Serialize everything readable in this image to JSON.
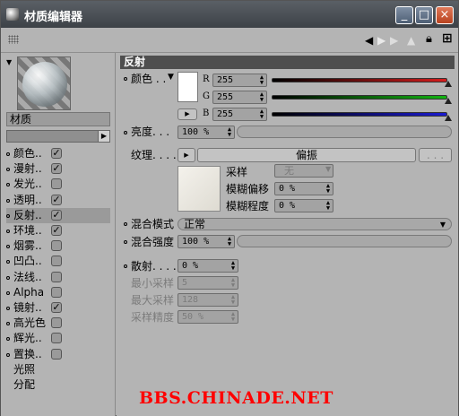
{
  "window": {
    "title": "材质编辑器",
    "min_label": "_",
    "max_label": "□",
    "close_label": "×"
  },
  "left": {
    "material_name": "材质",
    "channels": [
      {
        "label": "颜色..",
        "checked": true,
        "check": "✓"
      },
      {
        "label": "漫射..",
        "checked": true,
        "check": "✓"
      },
      {
        "label": "发光..",
        "checked": false,
        "check": ""
      },
      {
        "label": "透明..",
        "checked": true,
        "check": "✓"
      },
      {
        "label": "反射..",
        "checked": true,
        "check": "✓"
      },
      {
        "label": "环境..",
        "checked": true,
        "check": "✓"
      },
      {
        "label": "烟雾..",
        "checked": false,
        "check": ""
      },
      {
        "label": "凹凸..",
        "checked": false,
        "check": ""
      },
      {
        "label": "法线..",
        "checked": false,
        "check": ""
      },
      {
        "label": "Alpha",
        "checked": false,
        "check": ""
      },
      {
        "label": "镜射..",
        "checked": true,
        "check": "✓"
      },
      {
        "label": "高光色",
        "checked": false,
        "check": ""
      },
      {
        "label": "辉光..",
        "checked": false,
        "check": ""
      },
      {
        "label": "置换..",
        "checked": false,
        "check": ""
      }
    ],
    "extra_items": [
      "光照",
      "分配"
    ]
  },
  "reflection": {
    "header": "反射",
    "color_label": "颜色 . .",
    "r_label": "R",
    "g_label": "G",
    "b_label": "B",
    "r": "255",
    "g": "255",
    "b": "255",
    "brightness_label": "亮度. . .",
    "brightness": "100 %",
    "texture_label": "纹理. . . .",
    "texture_button": "偏振",
    "texture_more": ". . .",
    "sampling_label": "采样",
    "sampling": "无",
    "blur_offset_label": "模糊偏移",
    "blur_offset": "0 %",
    "blur_degree_label": "模糊程度",
    "blur_degree": "0 %",
    "mix_mode_label": "混合模式",
    "mix_mode": "正常",
    "mix_strength_label": "混合强度",
    "mix_strength": "100 %",
    "scatter_label": "散射. . . .",
    "scatter": "0 %",
    "min_samples_label": "最小采样",
    "min_samples": "5",
    "max_samples_label": "最大采样",
    "max_samples": "128",
    "sample_precision_label": "采样精度",
    "sample_precision": "50 %"
  },
  "watermark": "BBS.CHINADE.NET",
  "colors": {
    "red_track": "#d41c1c",
    "green_track": "#12b412",
    "blue_track": "#1a1ad0",
    "header_bg": "#4e4e4e",
    "watermark": "#ff0000"
  }
}
